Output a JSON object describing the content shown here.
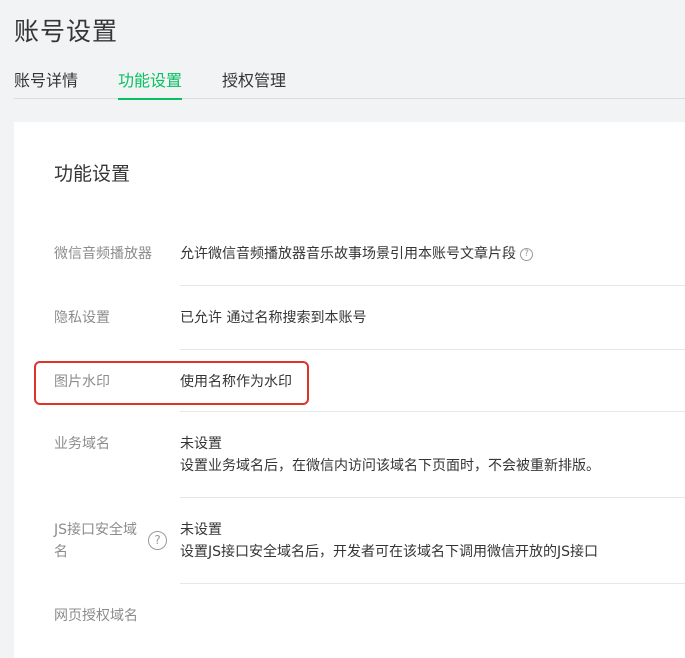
{
  "header": {
    "title": "账号设置",
    "tabs": [
      {
        "label": "账号详情",
        "active": false
      },
      {
        "label": "功能设置",
        "active": true
      },
      {
        "label": "授权管理",
        "active": false
      }
    ]
  },
  "card": {
    "title": "功能设置",
    "rows": [
      {
        "label": "微信音频播放器",
        "value": "允许微信音频播放器音乐故事场景引用本账号文章片段",
        "help_icon": "question-circle-icon"
      },
      {
        "label": "隐私设置",
        "value": "已允许 通过名称搜索到本账号"
      },
      {
        "label": "图片水印",
        "value": "使用名称作为水印",
        "highlighted": true
      },
      {
        "label": "业务域名",
        "value": "未设置",
        "description": "设置业务域名后，在微信内访问该域名下页面时，不会被重新排版。"
      },
      {
        "label": "JS接口安全域名",
        "label_line1": "JS接口安全域",
        "label_line2": "名",
        "value": "未设置",
        "description": "设置JS接口安全域名后，开发者可在该域名下调用微信开放的JS接口",
        "help_icon": "question-circle-icon"
      },
      {
        "label": "网页授权域名"
      }
    ]
  },
  "colors": {
    "accent": "#07c160",
    "highlight": "#e0312b"
  }
}
